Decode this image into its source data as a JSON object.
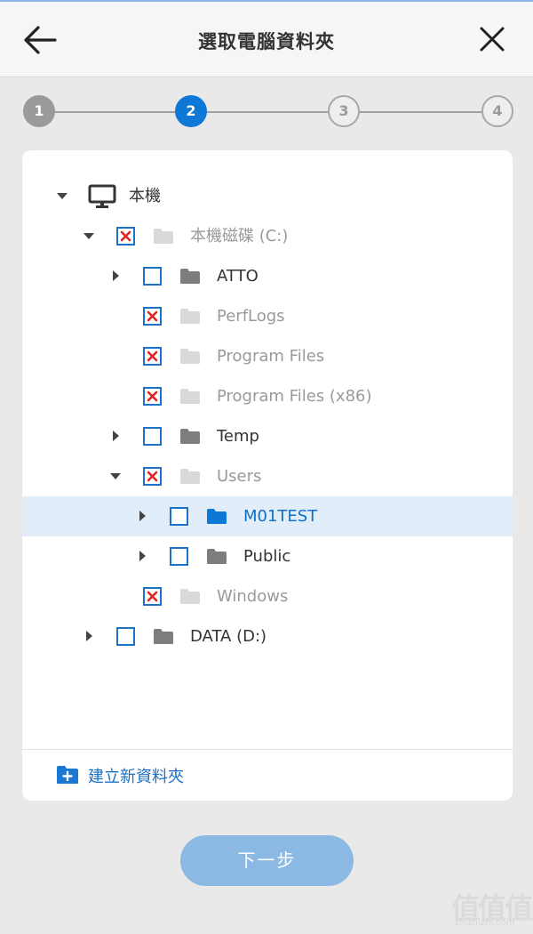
{
  "header": {
    "title": "選取電腦資料夾",
    "back_icon": "arrow-left-icon",
    "close_icon": "close-icon"
  },
  "stepper": {
    "steps": [
      {
        "label": "1",
        "state": "done"
      },
      {
        "label": "2",
        "state": "active"
      },
      {
        "label": "3",
        "state": "todo"
      },
      {
        "label": "4",
        "state": "todo"
      }
    ]
  },
  "tree": {
    "root_label": "本機",
    "items": [
      {
        "label": "本機磁碟 (C:)",
        "checked": "excluded",
        "expanded": true
      },
      {
        "label": "ATTO",
        "checked": "unchecked",
        "expanded": false
      },
      {
        "label": "PerfLogs",
        "checked": "excluded"
      },
      {
        "label": "Program Files",
        "checked": "excluded"
      },
      {
        "label": "Program Files (x86)",
        "checked": "excluded"
      },
      {
        "label": "Temp",
        "checked": "unchecked",
        "expanded": false
      },
      {
        "label": "Users",
        "checked": "excluded",
        "expanded": true
      },
      {
        "label": "M01TEST",
        "checked": "unchecked",
        "expanded": false,
        "selected": true
      },
      {
        "label": "Public",
        "checked": "unchecked",
        "expanded": false
      },
      {
        "label": "Windows",
        "checked": "excluded"
      },
      {
        "label": "DATA (D:)",
        "checked": "unchecked",
        "expanded": false
      }
    ]
  },
  "actions": {
    "new_folder_label": "建立新資料夾",
    "next_label": "下一步"
  },
  "watermark": {
    "glyphs": "值值值",
    "text": "zhizhizhi.com"
  },
  "colors": {
    "accent": "#0e78d6",
    "selected_row": "#e1eefa",
    "excluded_mark": "#e02424",
    "next_button": "#8bb9e3"
  }
}
